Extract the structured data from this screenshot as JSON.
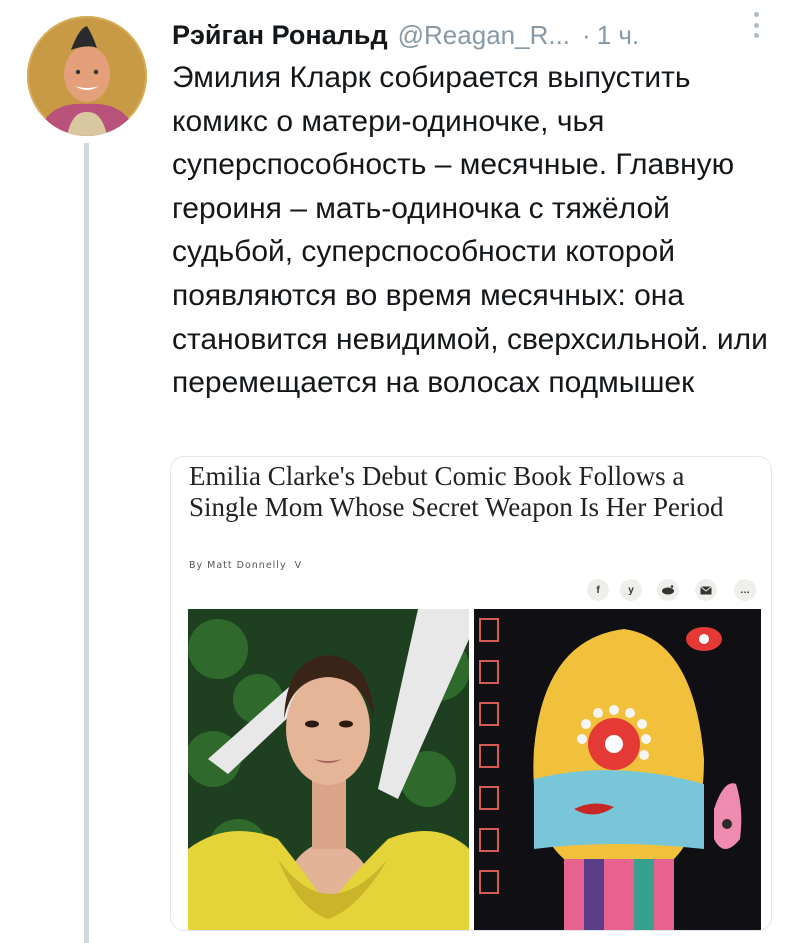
{
  "tweet": {
    "author_name": "Рэйган Рональд",
    "handle": "@Reagan_R...",
    "separator": "·",
    "time": "1 ч.",
    "text": "Эмилия Кларк собирается выпустить комикс о матери-одиночке, чья суперспособность – месячные. Главную героиня – мать-одиночка с тяжёлой судьбой, суперспособности которой появляются во время месячных: она становится невидимой, сверхсильной. или перемещается на волосах подмышек"
  },
  "card": {
    "title": "Emilia Clarke's Debut Comic Book Follows a Single Mom Whose Secret Weapon Is Her Period",
    "byline": "By Matt Donnelly",
    "byline_chevron": "V",
    "share_icons": [
      "facebook-icon",
      "twitter-icon",
      "reddit-icon",
      "email-icon",
      "more-icon"
    ],
    "share_labels": [
      "f",
      "y",
      "",
      "",
      "…"
    ]
  }
}
